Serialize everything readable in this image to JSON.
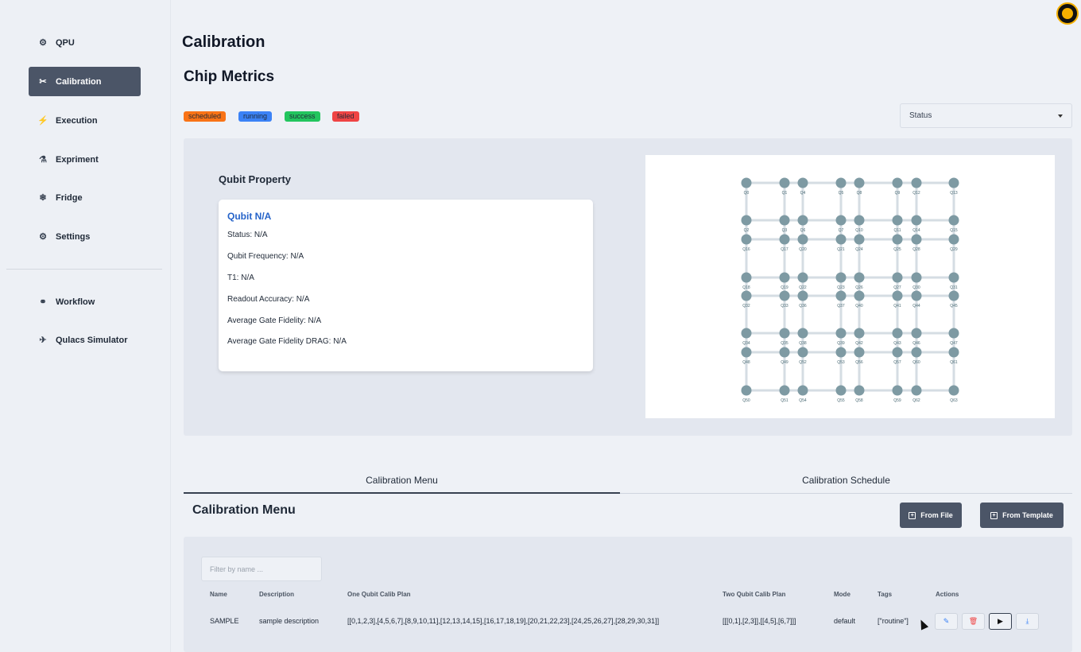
{
  "sidebar": {
    "items": [
      {
        "label": "QPU",
        "icon": "chip-icon",
        "glyph": "⚙"
      },
      {
        "label": "Calibration",
        "icon": "tools-icon",
        "glyph": "✂"
      },
      {
        "label": "Execution",
        "icon": "lightning-icon",
        "glyph": "⚡"
      },
      {
        "label": "Expriment",
        "icon": "flask-icon",
        "glyph": "⚗"
      },
      {
        "label": "Fridge",
        "icon": "snowflake-icon",
        "glyph": "❄"
      },
      {
        "label": "Settings",
        "icon": "gear-icon",
        "glyph": "⚙"
      },
      {
        "label": "Workflow",
        "icon": "workflow-icon",
        "glyph": "⚭"
      },
      {
        "label": "Qulacs Simulator",
        "icon": "bird-icon",
        "glyph": "✈"
      }
    ],
    "active_index": 1
  },
  "header": {
    "page_title": "Calibration",
    "section_title": "Chip Metrics"
  },
  "legend": {
    "scheduled": "scheduled",
    "running": "running",
    "success": "success",
    "failed": "failed"
  },
  "colors": {
    "scheduled": "#f97316",
    "running": "#3b82f6",
    "success": "#22c55e",
    "failed": "#ef4444",
    "node": "#7e9aa3",
    "edge": "#d5dde3",
    "accent": "#4b5567"
  },
  "status_select": {
    "value": "Status"
  },
  "qubit_property": {
    "title": "Qubit Property",
    "qubit_name": "Qubit N/A",
    "status": "Status: N/A",
    "frequency": "Qubit Frequency: N/A",
    "t1": "T1: N/A",
    "readout": "Readout Accuracy: N/A",
    "gate_fidelity": "Average Gate Fidelity: N/A",
    "gate_fidelity_drag": "Average Gate Fidelity DRAG: N/A"
  },
  "chip_map": {
    "labels": [
      [
        "Q0",
        "Q1",
        "Q4",
        "Q5",
        "Q8",
        "Q9",
        "Q12",
        "Q13"
      ],
      [
        "Q2",
        "Q3",
        "Q6",
        "Q7",
        "Q10",
        "Q11",
        "Q14",
        "Q15"
      ],
      [
        "Q16",
        "Q17",
        "Q20",
        "Q21",
        "Q24",
        "Q25",
        "Q28",
        "Q29"
      ],
      [
        "Q18",
        "Q19",
        "Q22",
        "Q23",
        "Q26",
        "Q27",
        "Q30",
        "Q31"
      ],
      [
        "Q32",
        "Q33",
        "Q36",
        "Q37",
        "Q40",
        "Q41",
        "Q44",
        "Q45"
      ],
      [
        "Q34",
        "Q35",
        "Q38",
        "Q39",
        "Q42",
        "Q43",
        "Q46",
        "Q47"
      ],
      [
        "Q48",
        "Q49",
        "Q52",
        "Q53",
        "Q56",
        "Q57",
        "Q60",
        "Q61"
      ],
      [
        "Q50",
        "Q51",
        "Q54",
        "Q55",
        "Q58",
        "Q59",
        "Q62",
        "Q63"
      ]
    ]
  },
  "tabs": [
    {
      "label": "Calibration Menu",
      "active": true
    },
    {
      "label": "Calibration Schedule",
      "active": false
    }
  ],
  "calibration_menu": {
    "title": "Calibration Menu",
    "from_file": "From File",
    "from_template": "From Template",
    "filter_placeholder": "Filter by name ...",
    "columns": [
      "Name",
      "Description",
      "One Qubit Calib Plan",
      "Two Qubit Calib Plan",
      "Mode",
      "Tags",
      "Actions"
    ],
    "rows": [
      {
        "name": "SAMPLE",
        "description": "sample description",
        "one_qubit_plan": "[[0,1,2,3],[4,5,6,7],[8,9,10,11],[12,13,14,15],[16,17,18,19],[20,21,22,23],[24,25,26,27],[28,29,30,31]]",
        "two_qubit_plan": "[[[0,1],[2,3]],[[4,5],[6,7]]]",
        "mode": "default",
        "tags": "[\"routine\"]"
      }
    ]
  }
}
